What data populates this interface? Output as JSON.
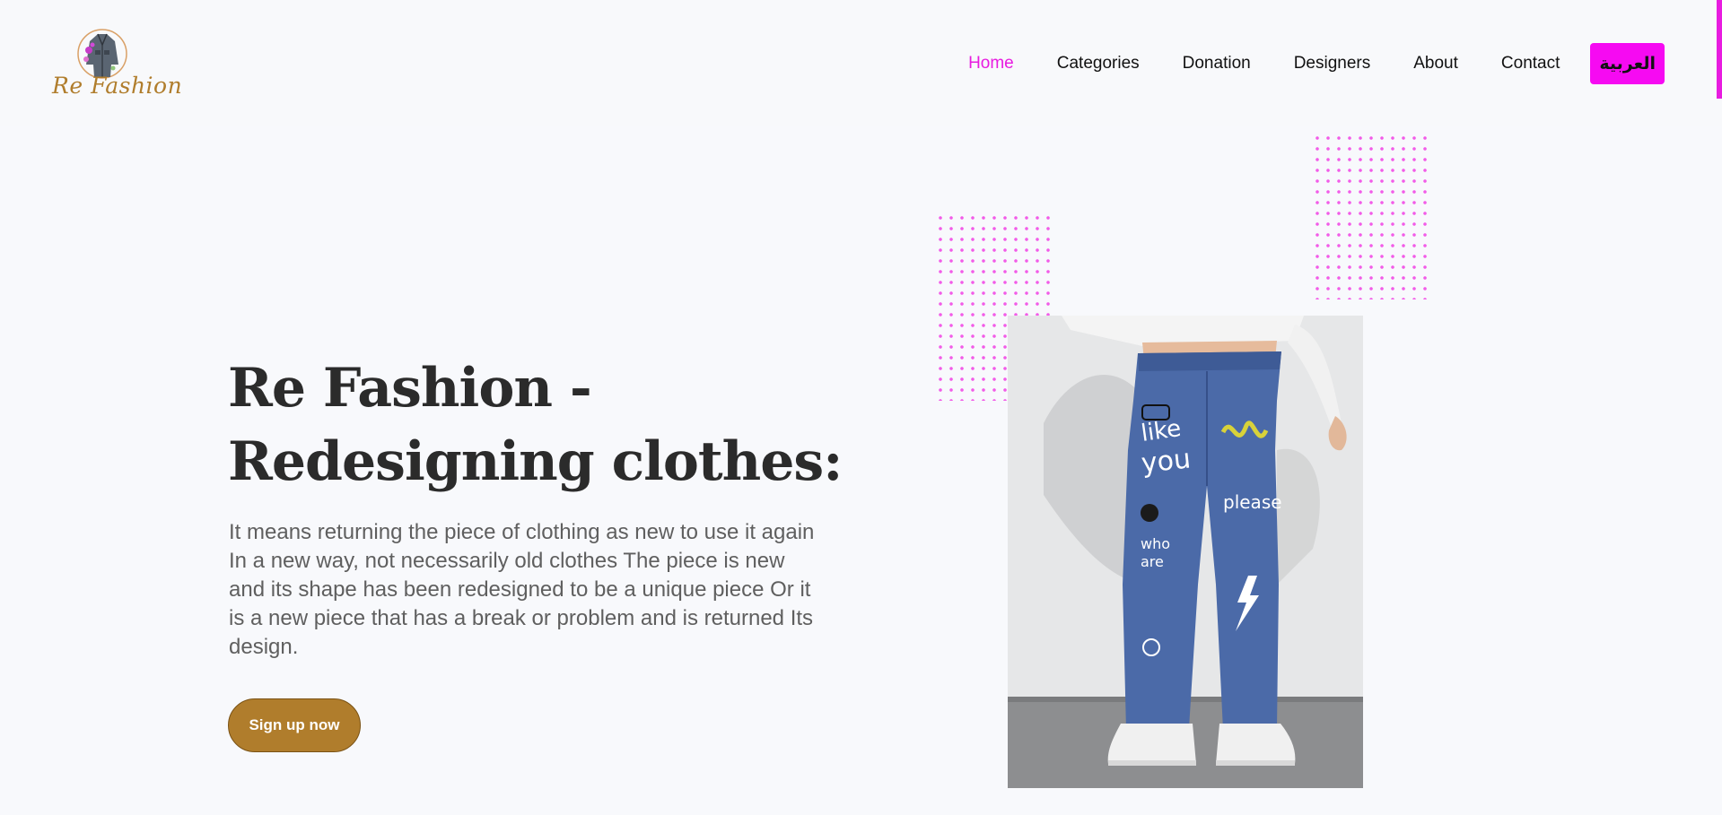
{
  "brand": {
    "name": "Re Fashion"
  },
  "nav": {
    "items": [
      {
        "label": "Home",
        "active": true
      },
      {
        "label": "Categories",
        "active": false
      },
      {
        "label": "Donation",
        "active": false
      },
      {
        "label": "Designers",
        "active": false
      },
      {
        "label": "About",
        "active": false
      },
      {
        "label": "Contact",
        "active": false
      }
    ],
    "language_button": "العربية"
  },
  "hero": {
    "title_line1": "Re Fashion -",
    "title_line2": "Redesigning clothes:",
    "description": "It means returning the piece of clothing as new to use it again In a new way, not necessarily old clothes The piece is new and its shape has been redesigned to be a unique piece Or it is a new piece that has a break or problem and is returned Its design.",
    "cta_label": "Sign up now"
  },
  "colors": {
    "accent": "#e81ce0",
    "language_button": "#f60af2",
    "brand_gold": "#b07d2c",
    "title": "#2b2b2b",
    "body_text": "#5f5f5f",
    "background": "#f8f9fc"
  },
  "icons": {
    "logo": "jacket-logo-icon",
    "photo": "graffiti-jeans-photo"
  }
}
